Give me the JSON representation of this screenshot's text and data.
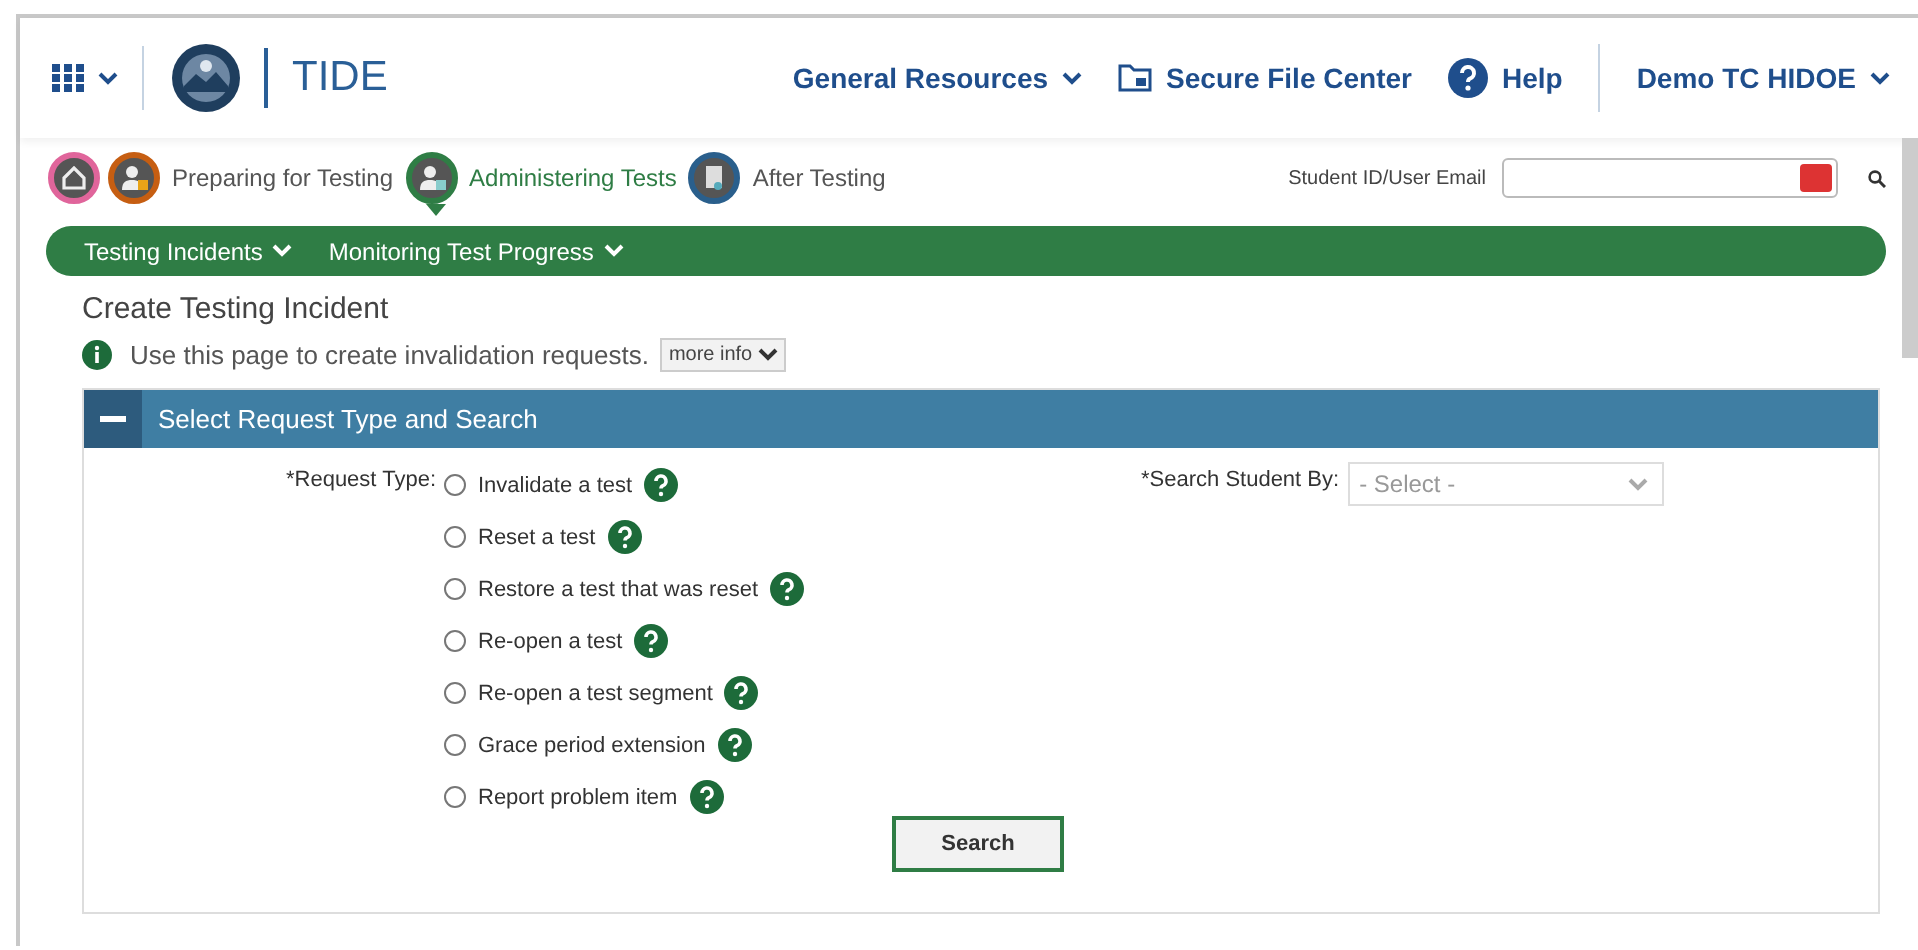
{
  "header": {
    "app_name": "TIDE",
    "links": [
      {
        "kind": "menu",
        "label": "General Resources"
      },
      {
        "kind": "folder",
        "label": "Secure File Center"
      },
      {
        "kind": "help",
        "label": "Help"
      }
    ],
    "user": "Demo TC HIDOE"
  },
  "phases": [
    {
      "kind": "prep",
      "label": "Preparing for Testing",
      "selected": false
    },
    {
      "kind": "admin",
      "label": "Administering Tests",
      "selected": true
    },
    {
      "kind": "after",
      "label": "After Testing",
      "selected": false
    }
  ],
  "lookup": {
    "label": "Student ID/User Email"
  },
  "subnav": [
    "Testing Incidents",
    "Monitoring Test Progress"
  ],
  "page_title": "Create Testing Incident",
  "info": {
    "text": "Use this page to create invalidation requests.",
    "more": "more info"
  },
  "panel": {
    "title": "Select Request Type and Search",
    "expanded": true,
    "request_label": "*Request Type:",
    "options": [
      {
        "label": "Invalidate a test",
        "checked": false
      },
      {
        "label": "Reset a test",
        "checked": false
      },
      {
        "label": "Restore a test that was reset",
        "checked": false
      },
      {
        "label": "Re-open a test",
        "checked": false
      },
      {
        "label": "Re-open a test segment",
        "checked": false
      },
      {
        "label": "Grace period extension",
        "checked": false
      },
      {
        "label": "Report problem item",
        "checked": false
      }
    ],
    "search_by_label": "*Search Student By:",
    "search_by_placeholder": "- Select -",
    "button": "Search"
  }
}
